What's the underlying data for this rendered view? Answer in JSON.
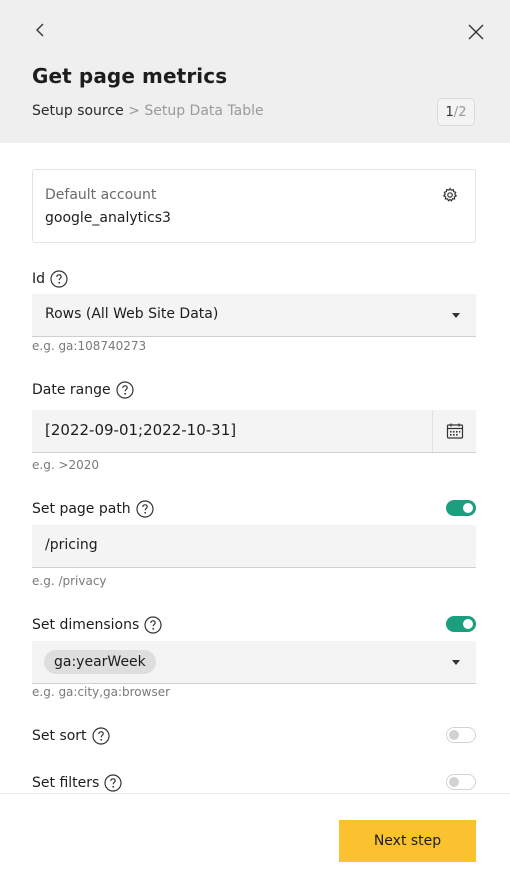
{
  "header": {
    "title": "Get page metrics",
    "breadcrumb": {
      "current": "Setup source",
      "separator": ">",
      "next": "Setup Data Table"
    },
    "step": {
      "current": "1",
      "divider": "/",
      "total": "2"
    }
  },
  "account": {
    "label": "Default account",
    "value": "google_analytics3"
  },
  "fields": {
    "id": {
      "label": "Id",
      "value": "Rows (All Web Site Data)",
      "hint": "e.g. ga:108740273"
    },
    "date_range": {
      "label": "Date range",
      "value": "[2022-09-01;2022-10-31]",
      "hint": "e.g. >2020"
    },
    "page_path": {
      "label": "Set page path",
      "value": "/pricing",
      "hint": "e.g. /privacy",
      "enabled": true
    },
    "dimensions": {
      "label": "Set dimensions",
      "chip": "ga:yearWeek",
      "hint": "e.g. ga:city,ga:browser",
      "enabled": true
    },
    "sort": {
      "label": "Set sort",
      "enabled": false
    },
    "filters": {
      "label": "Set filters",
      "enabled": false
    }
  },
  "footer": {
    "next_label": "Next step"
  },
  "colors": {
    "header_bg": "#efefef",
    "toggle_on": "#1b9f7e",
    "primary_button": "#f9c22e"
  },
  "icons": [
    "back-chevron-icon",
    "close-icon",
    "gear-icon",
    "help-icon",
    "calendar-icon",
    "dropdown-caret-icon"
  ]
}
